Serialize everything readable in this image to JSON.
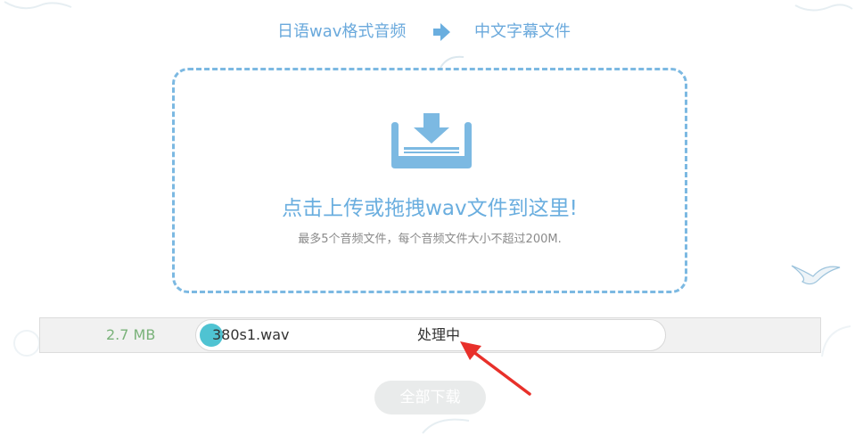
{
  "steps": {
    "from_label": "日语wav格式音频",
    "to_label": "中文字幕文件"
  },
  "colors": {
    "accent": "#6aaedf",
    "dash_border": "#7cb9e2",
    "size_text": "#7ab27a",
    "progress_fill": "#4fc3d2",
    "annotation": "#e8302a"
  },
  "dropzone": {
    "icon": "download-tray-icon",
    "title": "点击上传或拖拽wav文件到这里!",
    "hint": "最多5个音频文件，每个音频文件大小不超过200M."
  },
  "file": {
    "size": "2.7 MB",
    "name": "380s1.wav",
    "status": "处理中",
    "progress": 0.04
  },
  "download_all_label": "全部下载"
}
